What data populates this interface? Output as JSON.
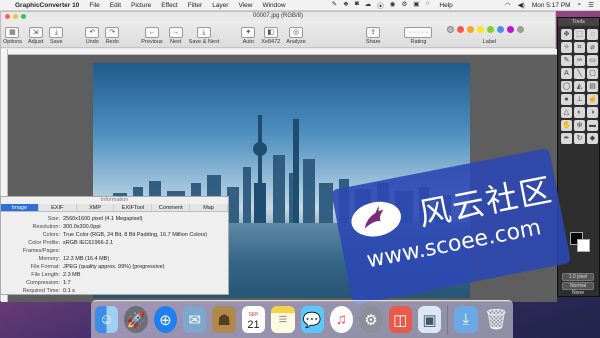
{
  "menubar": {
    "apple": "",
    "app_name": "GraphicConverter 10",
    "items": [
      "File",
      "Edit",
      "Picture",
      "Effect",
      "Filter",
      "Layer",
      "View",
      "Window",
      "Help"
    ],
    "day_time": "Mon 5:17 PM"
  },
  "window": {
    "title": "00007.jpg (RGB/8)"
  },
  "toolbar": {
    "options": "Options",
    "adjust": "Adjust",
    "save": "Save",
    "undo": "Undo",
    "redo": "Redo",
    "previous": "Previous",
    "next": "Next",
    "save_next": "Save & Next",
    "auto": "Auto",
    "xe8472": "Xe8472",
    "analyze": "Analyze",
    "share": "Share",
    "rating": "Rating",
    "label": "Label",
    "label_colors": [
      "#f15a4a",
      "#f5a623",
      "#f8e71c",
      "#7ed321",
      "#4a90e2",
      "#bd10e0",
      "#9b9b9b"
    ]
  },
  "tools_palette": {
    "title": "Tools",
    "zoom_value": "1.0 pixel",
    "blend_mode": "Normal",
    "option": "None"
  },
  "information": {
    "title": "Information",
    "tabs": [
      "Image",
      "EXIF",
      "XMP",
      "EXIFTool",
      "Comment",
      "Map"
    ],
    "active_tab": "Image",
    "rows": [
      {
        "k": "Size:",
        "v": "2560x1600 pixel (4.1 Megapixel)"
      },
      {
        "k": "Resolution:",
        "v": "300.0x300.0ppi"
      },
      {
        "k": "Colors:",
        "v": "True Color (RGB, 24 Bit, 8 Bit Padding, 16.7 Million Colors)"
      },
      {
        "k": "Color Profile:",
        "v": "sRGB IEC61966-2.1"
      },
      {
        "k": "Frames/Pages:",
        "v": ""
      },
      {
        "k": "Memory:",
        "v": "12.3 MB (16.4 MB)"
      },
      {
        "k": "File Format:",
        "v": "JPEG (quality approx. 99%) (progressive)"
      },
      {
        "k": "File Length:",
        "v": "2.3 MB"
      },
      {
        "k": "Compression:",
        "v": "1:7"
      },
      {
        "k": "Required Time:",
        "v": "0.1 s"
      }
    ]
  },
  "watermark": {
    "chinese": "风云社区",
    "url": "www.scoee.com"
  },
  "dock": {
    "calendar_month": "SEP",
    "calendar_day": "21"
  }
}
